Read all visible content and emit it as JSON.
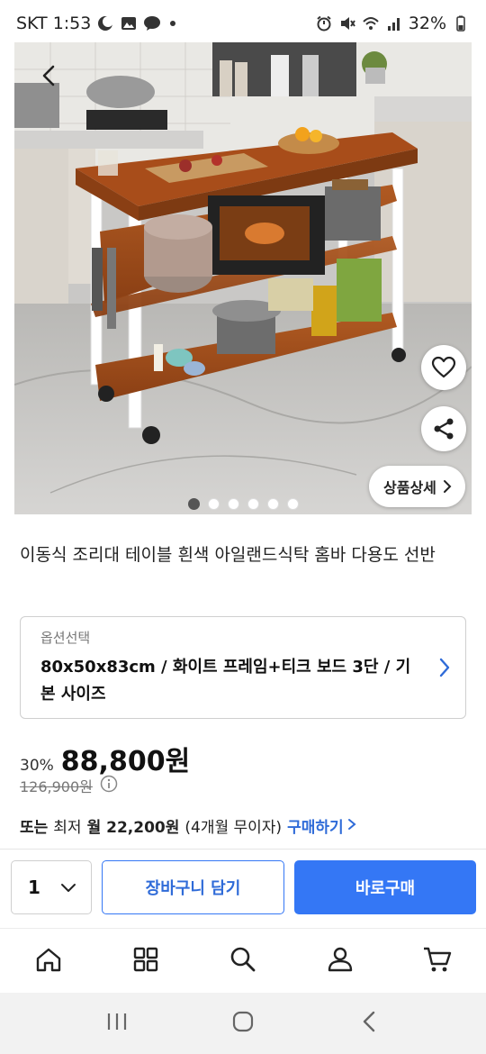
{
  "status_bar": {
    "carrier_time": "SKT 1:53",
    "battery": "32%"
  },
  "product": {
    "title": "이동식 조리대 테이블 흰색 아일랜드식탁 홈바 다용도 선반",
    "detail_button": "상품상세",
    "image_count": 6,
    "active_image": 1
  },
  "option": {
    "label": "옵션선택",
    "value": "80x50x83cm / 화이트 프레임+티크 보드 3단 / 기본 사이즈"
  },
  "price": {
    "discount": "30%",
    "sale_price": "88,800원",
    "original_price": "126,900원"
  },
  "installment": {
    "prefix": "또는",
    "text_min": "최저",
    "text_month": "월 22,200원",
    "text_terms": "(4개월 무이자)",
    "buy_link": "구매하기"
  },
  "purchase_bar": {
    "quantity": "1",
    "cart_button": "장바구니 담기",
    "buy_button": "바로구매"
  },
  "colors": {
    "accent": "#3477f5",
    "link": "#2f6bd8"
  },
  "bottom_nav": [
    "home-icon",
    "category-icon",
    "search-icon",
    "my-account-icon",
    "cart-icon"
  ],
  "system_nav": [
    "recent-apps-icon",
    "home-button-icon",
    "back-icon"
  ]
}
